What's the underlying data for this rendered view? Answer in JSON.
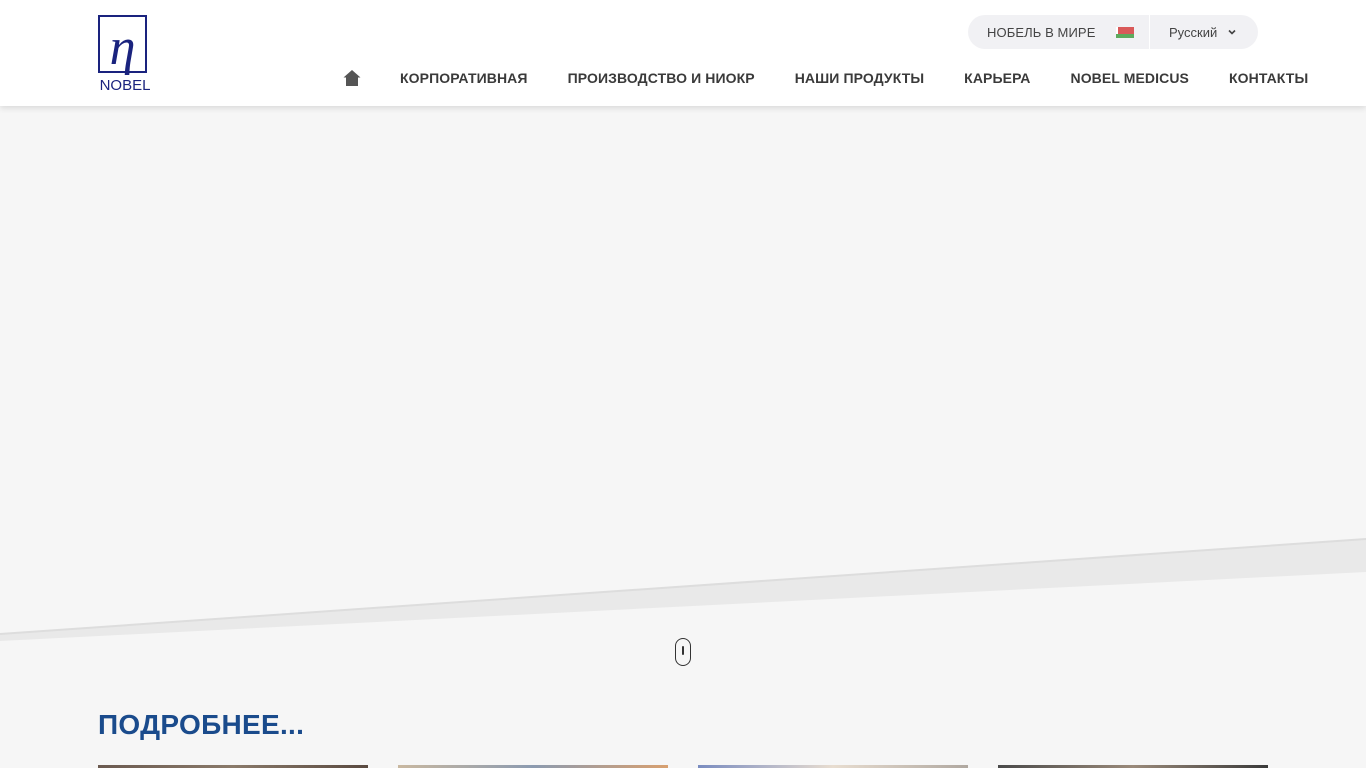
{
  "header": {
    "logo_text": "NOBEL",
    "world_label": "НОБЕЛЬ В МИРЕ",
    "language": "Русский",
    "nav": [
      {
        "label": "КОРПОРАТИВНАЯ"
      },
      {
        "label": "ПРОИЗВОДСТВО И НИОКР"
      },
      {
        "label": "НАШИ ПРОДУКТЫ"
      },
      {
        "label": "КАРЬЕРА"
      },
      {
        "label": "NOBEL MEDICUS"
      },
      {
        "label": "КОНТАКТЫ"
      }
    ]
  },
  "section": {
    "title": "ПОДРОБНЕЕ..."
  },
  "colors": {
    "brand_blue": "#1a237e",
    "title_blue": "#1a4b8c",
    "nav_text": "#3a3a3a",
    "page_bg": "#f6f6f6"
  },
  "icons": {
    "home": "home-icon",
    "chevron": "chevron-down-icon",
    "scroll": "mouse-scroll-icon",
    "flag": "belarus-flag-icon"
  }
}
